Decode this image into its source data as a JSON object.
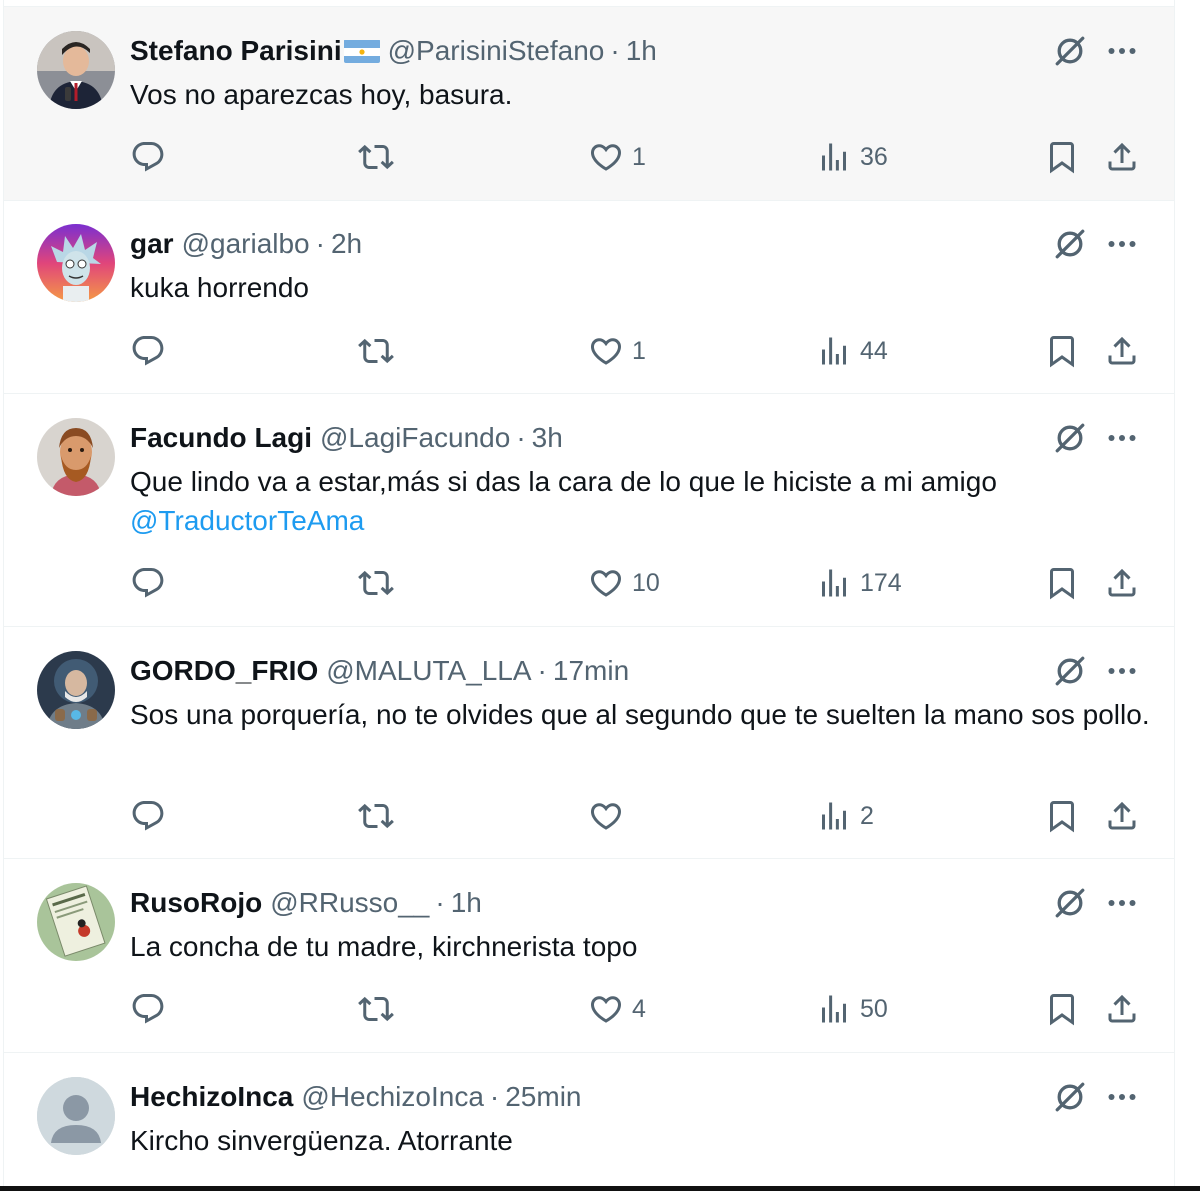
{
  "colors": {
    "link": "#1d9bf0",
    "muted": "#536471",
    "text": "#0f1419",
    "hover_bg": "#f7f7f7"
  },
  "tweets": [
    {
      "name": "Stefano Parisini",
      "handle": "@ParisiniStefano",
      "time": "1h",
      "text": "Vos no aparezcas hoy, basura.",
      "mention": "",
      "likes": "1",
      "views": "36"
    },
    {
      "name": "gar",
      "handle": "@garialbo",
      "time": "2h",
      "text": "kuka horrendo",
      "mention": "",
      "likes": "1",
      "views": "44"
    },
    {
      "name": "Facundo Lagi",
      "handle": "@LagiFacundo",
      "time": "3h",
      "text": "Que lindo va a estar,más si das la cara de lo que le hiciste a mi amigo",
      "mention": "@TraductorTeAma",
      "likes": "10",
      "views": "174"
    },
    {
      "name": "GORDO_FRIO",
      "handle": "@MALUTA_LLA",
      "time": "17min",
      "text": "Sos una porquería, no te olvides que al segundo que te suelten la mano sos pollo.",
      "mention": "",
      "likes": "",
      "views": "2"
    },
    {
      "name": "RusoRojo",
      "handle": "@RRusso__",
      "time": "1h",
      "text": "La concha de tu madre, kirchnerista topo",
      "mention": "",
      "likes": "4",
      "views": "50"
    },
    {
      "name": "HechizoInca",
      "handle": "@HechizoInca",
      "time": "25min",
      "text": "Kircho sinvergüenza. Atorrante",
      "mention": "",
      "likes": "",
      "views": ""
    }
  ],
  "header_separator": "·",
  "icons": [
    "grok-icon",
    "more-icon",
    "reply-icon",
    "retweet-icon",
    "like-icon",
    "views-icon",
    "bookmark-icon",
    "share-icon",
    "argentina-flag-icon"
  ]
}
